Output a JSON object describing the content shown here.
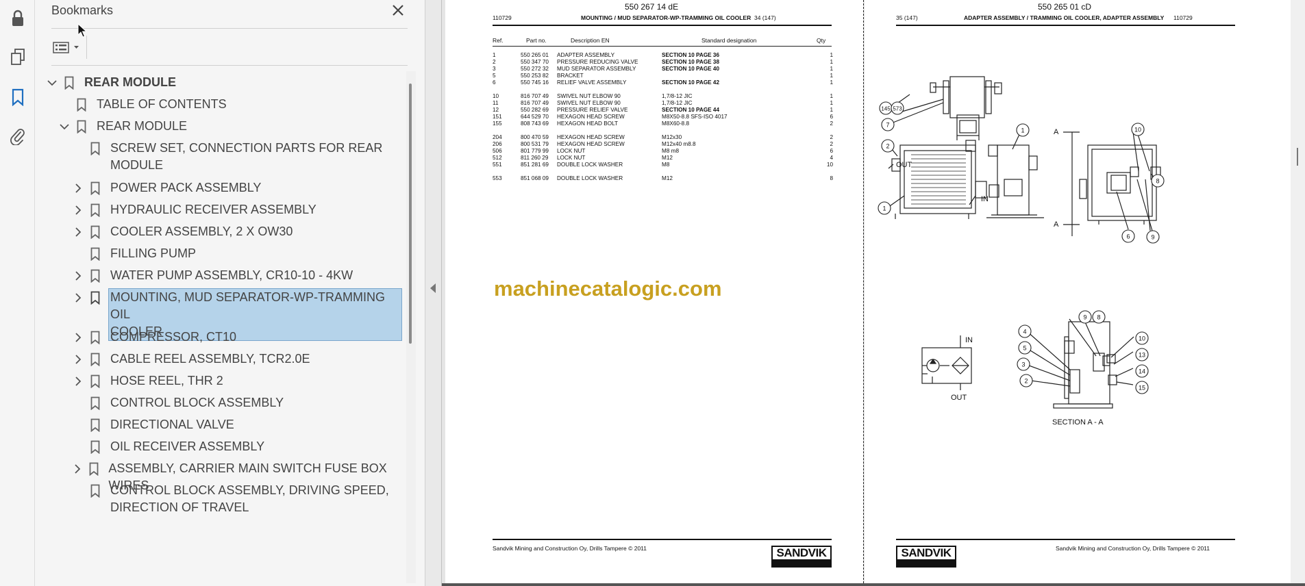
{
  "rail": {
    "tools": [
      "lock-icon",
      "pages-icon",
      "bookmark-icon",
      "attachment-icon"
    ]
  },
  "bookmarks": {
    "title": "Bookmarks",
    "items": [
      {
        "label": "REAR MODULE"
      },
      {
        "label": "TABLE OF CONTENTS"
      },
      {
        "label": "REAR MODULE"
      },
      {
        "label": "SCREW SET, CONNECTION PARTS FOR REAR",
        "label2": "MODULE"
      },
      {
        "label": "POWER PACK ASSEMBLY"
      },
      {
        "label": "HYDRAULIC RECEIVER ASSEMBLY"
      },
      {
        "label": "COOLER ASSEMBLY, 2 X OW30"
      },
      {
        "label": "FILLING PUMP"
      },
      {
        "label": "WATER PUMP ASSEMBLY, CR10-10 - 4KW"
      },
      {
        "label": "MOUNTING, MUD SEPARATOR-WP-TRAMMING OIL",
        "label2": "COOLER"
      },
      {
        "label": "COMPRESSOR, CT10"
      },
      {
        "label": "CABLE REEL ASSEMBLY, TCR2.0E"
      },
      {
        "label": "HOSE REEL, THR 2"
      },
      {
        "label": "CONTROL BLOCK ASSEMBLY"
      },
      {
        "label": "DIRECTIONAL VALVE"
      },
      {
        "label": "OIL RECEIVER ASSEMBLY"
      },
      {
        "label": "ASSEMBLY, CARRIER MAIN SWITCH FUSE BOX WIRES"
      },
      {
        "label": "CONTROL BLOCK ASSEMBLY, DRIVING SPEED,",
        "label2": "DIRECTION OF TRAVEL"
      }
    ]
  },
  "page_left": {
    "doc_number": "550 267 14 dE",
    "code": "110729",
    "title": "MOUNTING / MUD SEPARATOR-WP-TRAMMING OIL COOLER",
    "page_no": "34 (147)",
    "columns": [
      "Ref.",
      "Part no.",
      "Description EN",
      "Standard designation",
      "Qty"
    ],
    "rows": [
      [
        "1",
        "550 265 01",
        "ADAPTER ASSEMBLY",
        "SECTION 10 PAGE 36",
        "1"
      ],
      [
        "2",
        "550 347 70",
        "PRESSURE REDUCING VALVE",
        "SECTION 10 PAGE 38",
        "1"
      ],
      [
        "3",
        "550 272 32",
        "MUD SEPARATOR ASSEMBLY",
        "SECTION 10 PAGE 40",
        "1"
      ],
      [
        "5",
        "550 253 82",
        "BRACKET",
        "",
        "1"
      ],
      [
        "6",
        "550 745 16",
        "RELIEF VALVE ASSEMBLY",
        "SECTION 10 PAGE 42",
        "1"
      ],
      [
        "10",
        "816 707 49",
        "SWIVEL NUT ELBOW 90",
        "1,7/8-12 JIC",
        "1"
      ],
      [
        "11",
        "816 707 49",
        "SWIVEL NUT ELBOW 90",
        "1,7/8-12 JIC",
        "1"
      ],
      [
        "12",
        "550 282 69",
        "PRESSURE RELIEF VALVE",
        "SECTION 10 PAGE 44",
        "1"
      ],
      [
        "151",
        "644 529 70",
        "HEXAGON HEAD SCREW",
        "M8X50-8.8 SFS-ISO 4017",
        "6"
      ],
      [
        "155",
        "808 743 69",
        "HEXAGON HEAD BOLT",
        "M8X60-8.8",
        "2"
      ],
      [
        "204",
        "800 470 59",
        "HEXAGON HEAD SCREW",
        "M12x30",
        "2"
      ],
      [
        "206",
        "800 531 79",
        "HEXAGON HEAD SCREW",
        "M12x40 m8.8",
        "2"
      ],
      [
        "506",
        "801 779 99",
        "LOCK NUT",
        "M8 m8",
        "6"
      ],
      [
        "512",
        "811 260 29",
        "LOCK NUT",
        "M12",
        "4"
      ],
      [
        "551",
        "851 281 69",
        "DOUBLE LOCK WASHER",
        "M8",
        "10"
      ],
      [
        "553",
        "851 068 09",
        "DOUBLE LOCK WASHER",
        "M12",
        "8"
      ]
    ],
    "watermark": "machinecatalogic.com",
    "footer": "Sandvik Mining and Construction Oy, Drills Tampere © 2011",
    "logo": "SANDVIK"
  },
  "page_right": {
    "doc_number": "550 265 01 cD",
    "page_no": "35 (147)",
    "title": "ADAPTER ASSEMBLY / TRAMMING OIL COOLER, ADAPTER ASSEMBLY",
    "code": "110729",
    "footer": "Sandvik Mining and Construction Oy, Drills Tampere © 2011",
    "logo": "SANDVIK",
    "drawing_labels": {
      "section_caption": "SECTION  A - A",
      "out": "OUT",
      "in": "IN",
      "section_marker": "A",
      "balloons": [
        "145",
        "573",
        "7",
        "2",
        "1",
        "1",
        "10",
        "8",
        "6",
        "9",
        "8",
        "9",
        "10",
        "4",
        "5",
        "13",
        "3",
        "14",
        "2",
        "15"
      ]
    }
  }
}
